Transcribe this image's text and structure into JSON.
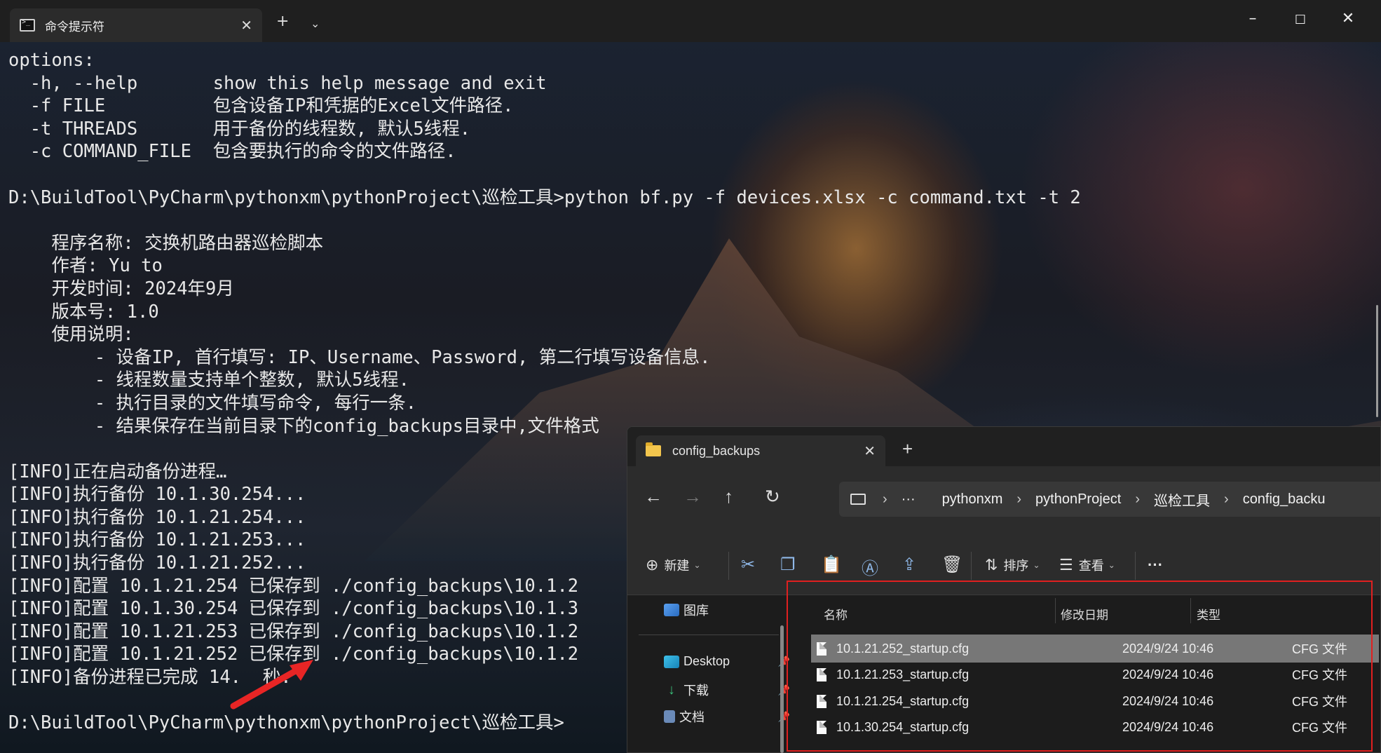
{
  "terminal": {
    "tab_title": "命令提示符",
    "lines": [
      "options:",
      "  -h, --help       show this help message and exit",
      "  -f FILE          包含设备IP和凭据的Excel文件路径.",
      "  -t THREADS       用于备份的线程数, 默认5线程.",
      "  -c COMMAND_FILE  包含要执行的命令的文件路径.",
      "",
      "D:\\BuildTool\\PyCharm\\pythonxm\\pythonProject\\巡检工具>python bf.py -f devices.xlsx -c command.txt -t 2",
      "",
      "    程序名称: 交换机路由器巡检脚本",
      "    作者: Yu to",
      "    开发时间: 2024年9月",
      "    版本号: 1.0",
      "    使用说明:",
      "        - 设备IP, 首行填写: IP、Username、Password, 第二行填写设备信息.",
      "        - 线程数量支持单个整数, 默认5线程.",
      "        - 执行目录的文件填写命令, 每行一条.",
      "        - 结果保存在当前目录下的config_backups目录中,文件格式",
      "",
      "[INFO]正在启动备份进程…",
      "[INFO]执行备份 10.1.30.254...",
      "[INFO]执行备份 10.1.21.254...",
      "[INFO]执行备份 10.1.21.253...",
      "[INFO]执行备份 10.1.21.252...",
      "[INFO]配置 10.1.21.254 已保存到 ./config_backups\\10.1.2",
      "[INFO]配置 10.1.30.254 已保存到 ./config_backups\\10.1.3",
      "[INFO]配置 10.1.21.253 已保存到 ./config_backups\\10.1.2",
      "[INFO]配置 10.1.21.252 已保存到 ./config_backups\\10.1.2",
      "[INFO]备份进程已完成 14.  秒.",
      "",
      "D:\\BuildTool\\PyCharm\\pythonxm\\pythonProject\\巡检工具>"
    ]
  },
  "explorer": {
    "tab_title": "config_backups",
    "breadcrumb": [
      "pythonxm",
      "pythonProject",
      "巡检工具",
      "config_backu"
    ],
    "more": "···",
    "toolbar": {
      "new_label": "新建",
      "sort_label": "排序",
      "view_label": "查看",
      "more": "···"
    },
    "sidebar": {
      "gallery": "图库",
      "desktop": "Desktop",
      "downloads": "下载",
      "documents": "文档"
    },
    "columns": {
      "name": "名称",
      "date": "修改日期",
      "type": "类型"
    },
    "files": [
      {
        "name": "10.1.21.252_startup.cfg",
        "date": "2024/9/24 10:46",
        "type": "CFG 文件"
      },
      {
        "name": "10.1.21.253_startup.cfg",
        "date": "2024/9/24 10:46",
        "type": "CFG 文件"
      },
      {
        "name": "10.1.21.254_startup.cfg",
        "date": "2024/9/24 10:46",
        "type": "CFG 文件"
      },
      {
        "name": "10.1.30.254_startup.cfg",
        "date": "2024/9/24 10:46",
        "type": "CFG 文件"
      }
    ]
  },
  "colors": {
    "highlight_red": "#e02020",
    "folder_yellow": "#f3c64d"
  }
}
